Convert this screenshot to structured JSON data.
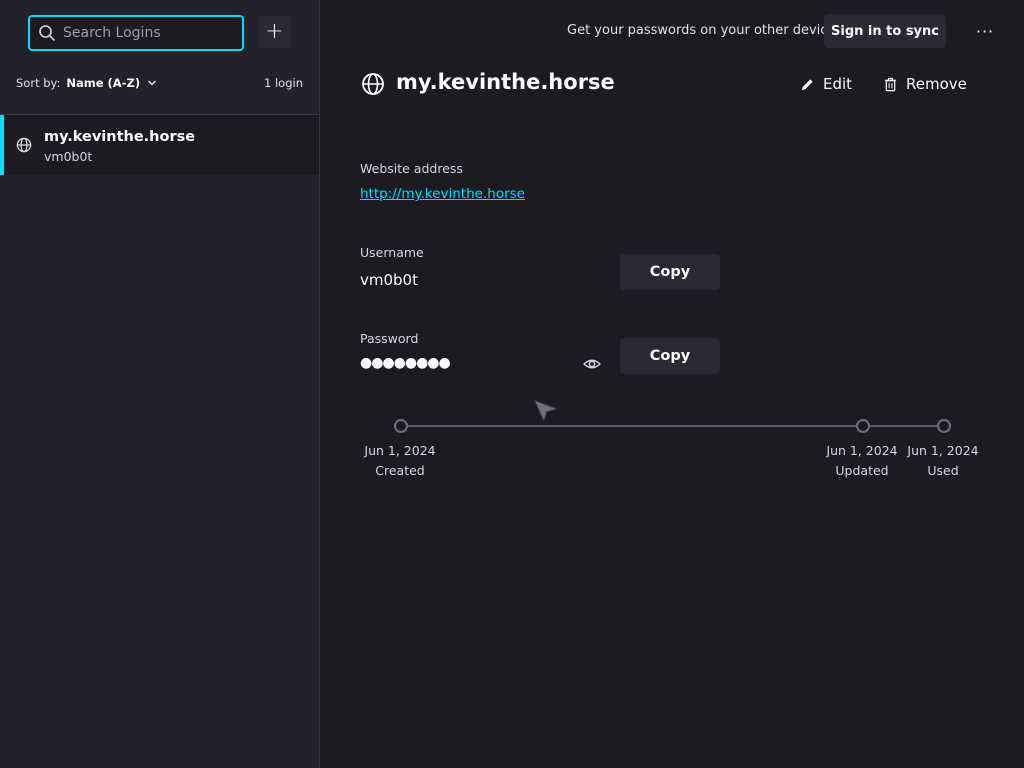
{
  "sidebar": {
    "search_placeholder": "Search Logins",
    "add_label": "+",
    "sort_prefix": "Sort by:",
    "sort_value": "Name (A-Z)",
    "login_count": "1 login",
    "items": [
      {
        "title": "my.kevinthe.horse",
        "username": "vm0b0t"
      }
    ]
  },
  "header": {
    "sync_message": "Get your passwords on your other devices",
    "sign_in_label": "Sign in to sync",
    "more_label": "···"
  },
  "detail": {
    "title": "my.kevinthe.horse",
    "edit_label": "Edit",
    "remove_label": "Remove",
    "website_label": "Website address",
    "website_url": "http://my.kevinthe.horse",
    "username_label": "Username",
    "username_value": "vm0b0t",
    "password_label": "Password",
    "password_mask": "●●●●●●●●",
    "copy_label": "Copy"
  },
  "timeline": {
    "created_date": "Jun 1, 2024",
    "created_label": "Created",
    "updated_date": "Jun 1, 2024",
    "updated_label": "Updated",
    "used_date": "Jun 1, 2024",
    "used_label": "Used"
  },
  "colors": {
    "accent": "#00ddff",
    "background": "#1c1b22",
    "sidebar": "#23222b",
    "button": "#2b2a33"
  }
}
